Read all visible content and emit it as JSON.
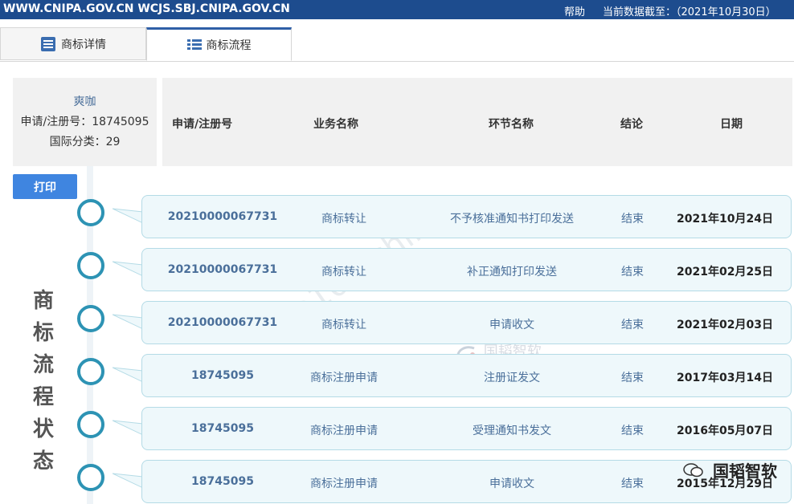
{
  "topbar": {
    "urls": "WWW.CNIPA.GOV.CN WCJS.SBJ.CNIPA.GOV.CN",
    "help": "帮助",
    "asof": "当前数据截至：（2021年10月30日）"
  },
  "tabs": [
    {
      "label": "商标详情",
      "icon": "list-icon",
      "active": false
    },
    {
      "label": "商标流程",
      "icon": "bullet-list-icon",
      "active": true
    }
  ],
  "info": {
    "name": "爽咖",
    "reg_no": "申请/注册号：18745095",
    "class": "国际分类：29"
  },
  "headers": {
    "reg_no": "申请/注册号",
    "business": "业务名称",
    "node": "环节名称",
    "result": "结论",
    "date": "日期"
  },
  "print_label": "打印",
  "side_label": [
    "商",
    "标",
    "流",
    "程",
    "状",
    "态"
  ],
  "watermarks": {
    "diag": "tm100-china",
    "logo": "国韬智软",
    "corner": "国韬智软"
  },
  "rows": [
    {
      "reg_no": "20210000067731",
      "business": "商标转让",
      "node": "不予核准通知书打印发送",
      "result": "结束",
      "date": "2021年10月24日"
    },
    {
      "reg_no": "20210000067731",
      "business": "商标转让",
      "node": "补正通知打印发送",
      "result": "结束",
      "date": "2021年02月25日"
    },
    {
      "reg_no": "20210000067731",
      "business": "商标转让",
      "node": "申请收文",
      "result": "结束",
      "date": "2021年02月03日"
    },
    {
      "reg_no": "18745095",
      "business": "商标注册申请",
      "node": "注册证发文",
      "result": "结束",
      "date": "2017年03月14日"
    },
    {
      "reg_no": "18745095",
      "business": "商标注册申请",
      "node": "受理通知书发文",
      "result": "结束",
      "date": "2016年05月07日"
    },
    {
      "reg_no": "18745095",
      "business": "商标注册申请",
      "node": "申请收文",
      "result": "结束",
      "date": "2015年12月29日"
    }
  ],
  "colors": {
    "topbar": "#1d4c8e",
    "accent": "#2d93b4",
    "print": "#3f85e0",
    "row_bg": "#eef8fb"
  }
}
